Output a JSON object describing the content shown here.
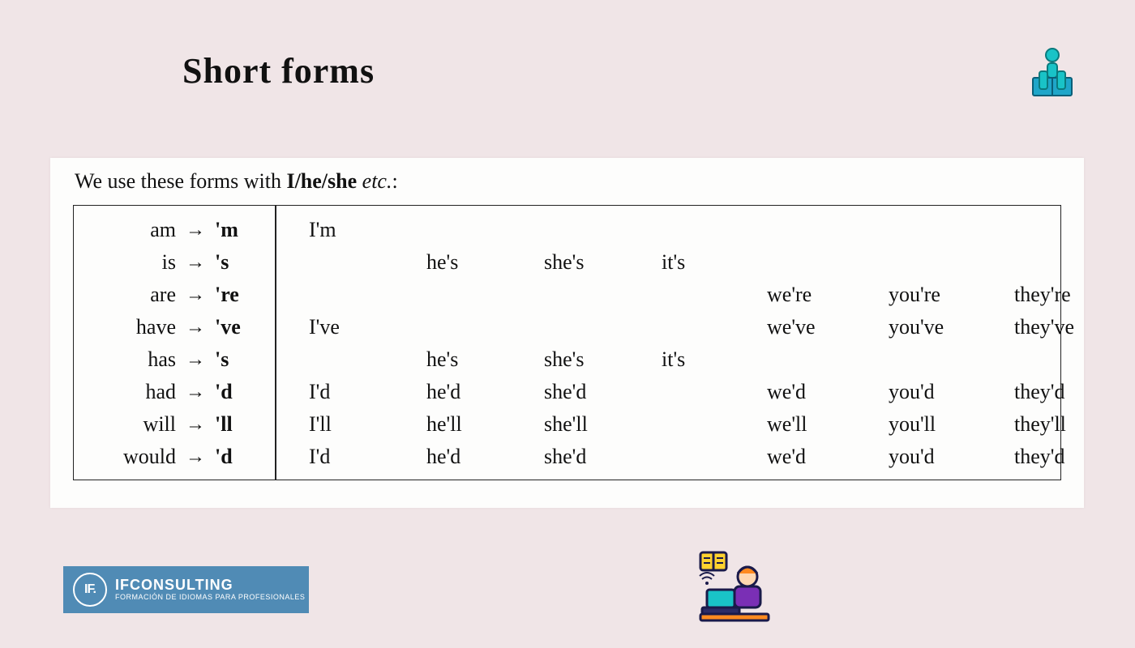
{
  "title": "Short forms",
  "intro": {
    "prefix": "We use these forms with ",
    "bold": "I/he/she",
    "italic": " etc.",
    "suffix": ":"
  },
  "arrow": "→",
  "rows": [
    {
      "full": "am",
      "short": "'m",
      "I": "I'm",
      "he": "",
      "she": "",
      "it": "",
      "we": "",
      "you": "",
      "they": ""
    },
    {
      "full": "is",
      "short": "'s",
      "I": "",
      "he": "he's",
      "she": "she's",
      "it": "it's",
      "we": "",
      "you": "",
      "they": ""
    },
    {
      "full": "are",
      "short": "'re",
      "I": "",
      "he": "",
      "she": "",
      "it": "",
      "we": "we're",
      "you": "you're",
      "they": "they're"
    },
    {
      "full": "have",
      "short": "'ve",
      "I": "I've",
      "he": "",
      "she": "",
      "it": "",
      "we": "we've",
      "you": "you've",
      "they": "they've"
    },
    {
      "full": "has",
      "short": "'s",
      "I": "",
      "he": "he's",
      "she": "she's",
      "it": "it's",
      "we": "",
      "you": "",
      "they": ""
    },
    {
      "full": "had",
      "short": "'d",
      "I": "I'd",
      "he": "he'd",
      "she": "she'd",
      "it": "",
      "we": "we'd",
      "you": "you'd",
      "they": "they'd"
    },
    {
      "full": "will",
      "short": "'ll",
      "I": "I'll",
      "he": "he'll",
      "she": "she'll",
      "it": "",
      "we": "we'll",
      "you": "you'll",
      "they": "they'll"
    },
    {
      "full": "would",
      "short": "'d",
      "I": "I'd",
      "he": "he'd",
      "she": "she'd",
      "it": "",
      "we": "we'd",
      "you": "you'd",
      "they": "they'd"
    }
  ],
  "logo": {
    "badge": "IF.",
    "line1": "IFCONSULTING",
    "line2": "FORMACIÓN DE IDIOMAS PARA PROFESIONALES"
  }
}
